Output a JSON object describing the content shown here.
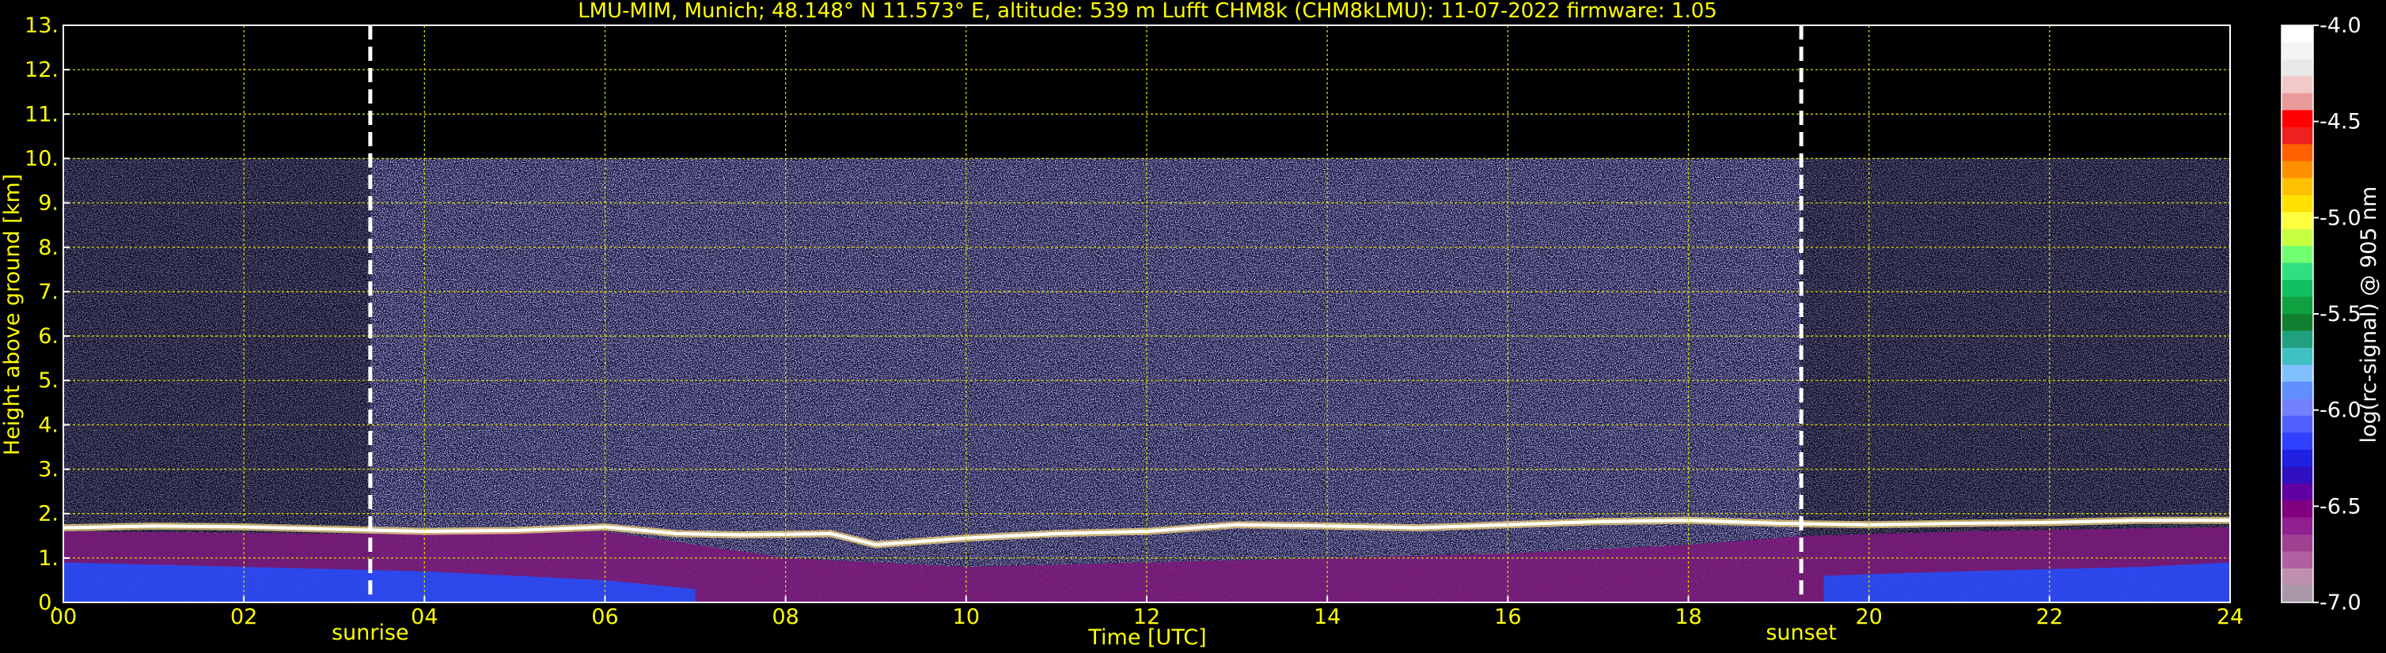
{
  "chart_data": {
    "type": "heatmap",
    "title": "LMU-MIM, Munich; 48.148° N 11.573° E, altitude: 539 m    Lufft CHM8k (CHM8kLMU): 11-07-2022    firmware: 1.05",
    "xlabel": "Time [UTC]",
    "ylabel": "Height above ground [km]",
    "colorbar_label": "log(rc-signal) @ 905 nm",
    "xlim": [
      0,
      24
    ],
    "ylim": [
      0,
      13
    ],
    "x_ticks": [
      0,
      2,
      4,
      6,
      8,
      10,
      12,
      14,
      16,
      18,
      20,
      22,
      24
    ],
    "x_tick_labels": [
      "00",
      "02",
      "04",
      "06",
      "08",
      "10",
      "12",
      "14",
      "16",
      "18",
      "20",
      "22",
      "24"
    ],
    "y_ticks": [
      0,
      1,
      2,
      3,
      4,
      5,
      6,
      7,
      8,
      9,
      10,
      11,
      12,
      13
    ],
    "y_tick_labels": [
      "0.",
      "1.",
      "2.",
      "3.",
      "4.",
      "5.",
      "6.",
      "7.",
      "8.",
      "9.",
      "10.",
      "11.",
      "12.",
      "13."
    ],
    "colorbar_range": [
      -7.0,
      -4.0
    ],
    "colorbar_ticks": [
      -4.0,
      -4.5,
      -5.0,
      -5.5,
      -6.0,
      -6.5,
      -7.0
    ],
    "colorbar_tick_labels": [
      "-4.0",
      "-4.5",
      "-5.0",
      "-5.5",
      "-6.0",
      "-6.5",
      "-7.0"
    ],
    "grid": true,
    "data_top_km": 10.0,
    "markers": [
      {
        "label": "sunrise",
        "x": 3.4
      },
      {
        "label": "sunset",
        "x": 19.25
      }
    ],
    "cloud_base_km": [
      {
        "x": 0,
        "y": 1.68
      },
      {
        "x": 1,
        "y": 1.72
      },
      {
        "x": 2,
        "y": 1.7
      },
      {
        "x": 3,
        "y": 1.65
      },
      {
        "x": 4,
        "y": 1.6
      },
      {
        "x": 5,
        "y": 1.62
      },
      {
        "x": 6,
        "y": 1.7
      },
      {
        "x": 6.8,
        "y": 1.55
      },
      {
        "x": 7.5,
        "y": 1.52
      },
      {
        "x": 8.5,
        "y": 1.55
      },
      {
        "x": 9,
        "y": 1.3
      },
      {
        "x": 10,
        "y": 1.45
      },
      {
        "x": 11,
        "y": 1.55
      },
      {
        "x": 12,
        "y": 1.6
      },
      {
        "x": 13,
        "y": 1.75
      },
      {
        "x": 14,
        "y": 1.72
      },
      {
        "x": 15,
        "y": 1.68
      },
      {
        "x": 16,
        "y": 1.75
      },
      {
        "x": 17,
        "y": 1.82
      },
      {
        "x": 18,
        "y": 1.85
      },
      {
        "x": 19,
        "y": 1.78
      },
      {
        "x": 20,
        "y": 1.75
      },
      {
        "x": 21,
        "y": 1.78
      },
      {
        "x": 22,
        "y": 1.8
      },
      {
        "x": 23,
        "y": 1.85
      },
      {
        "x": 24,
        "y": 1.85
      }
    ],
    "aerosol_top_km": [
      {
        "x": 0,
        "y": 1.6
      },
      {
        "x": 3,
        "y": 1.55
      },
      {
        "x": 6,
        "y": 1.6
      },
      {
        "x": 8,
        "y": 1.0
      },
      {
        "x": 10,
        "y": 0.8
      },
      {
        "x": 12,
        "y": 0.9
      },
      {
        "x": 14,
        "y": 1.0
      },
      {
        "x": 16,
        "y": 1.1
      },
      {
        "x": 18,
        "y": 1.3
      },
      {
        "x": 19.3,
        "y": 1.5
      },
      {
        "x": 21,
        "y": 1.6
      },
      {
        "x": 24,
        "y": 1.7
      }
    ]
  },
  "colors": {
    "text": "#ffff00",
    "grid": "#d4d400",
    "marker": "#ffffff",
    "background": "#000000",
    "noise": "#4a4a9a",
    "cloud": "#ffffff"
  },
  "colormap": [
    "#ffffff",
    "#f4f4f4",
    "#e8e8e8",
    "#f2c8c8",
    "#e89a9a",
    "#ff0000",
    "#ee2020",
    "#ff6000",
    "#ff9000",
    "#ffc000",
    "#ffe000",
    "#ffff40",
    "#c8ff40",
    "#70ff70",
    "#30e080",
    "#10c060",
    "#10a040",
    "#108030",
    "#20a080",
    "#40c0c0",
    "#80c0ff",
    "#6090ff",
    "#7080ff",
    "#5060ff",
    "#3040ff",
    "#2020e0",
    "#3010c0",
    "#6000a0",
    "#800080",
    "#902090",
    "#a04090",
    "#b060a0",
    "#c090b0",
    "#a898a8"
  ]
}
